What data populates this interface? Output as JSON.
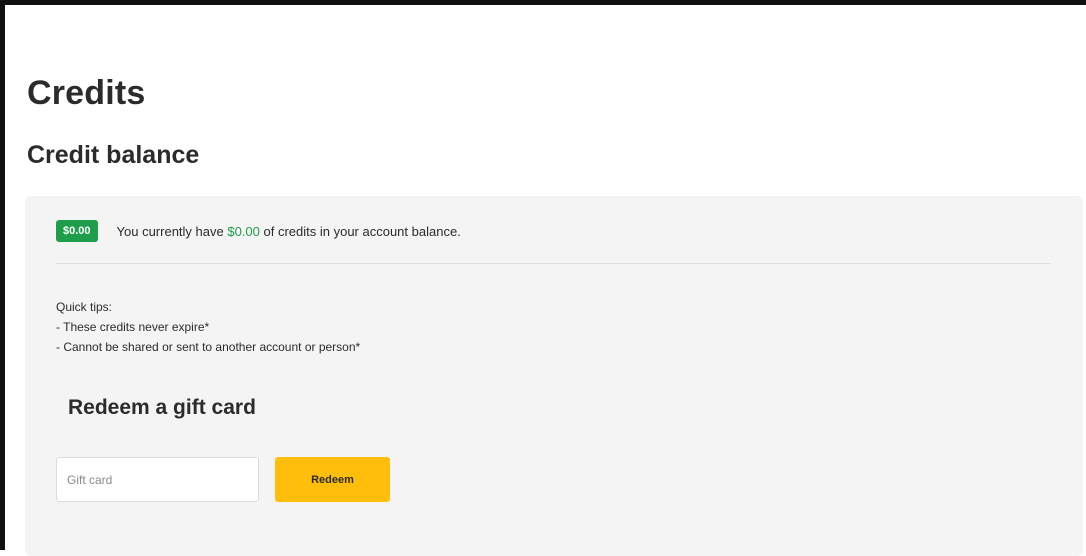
{
  "page": {
    "title": "Credits"
  },
  "balance": {
    "section_title": "Credit balance",
    "badge": "$0.00",
    "text_prefix": "You currently have ",
    "amount": "$0.00",
    "text_suffix": " of credits in your account balance."
  },
  "tips": {
    "heading": "Quick tips:",
    "items": [
      "- These credits never expire*",
      "- Cannot be shared or sent to another account or person*"
    ]
  },
  "gift_card": {
    "title": "Redeem a gift card",
    "input_placeholder": "Gift card",
    "input_value": "",
    "button_label": "Redeem"
  },
  "colors": {
    "accent_green": "#1e9e4a",
    "button_yellow": "#ffbe0b",
    "panel_bg": "#f4f4f4"
  }
}
